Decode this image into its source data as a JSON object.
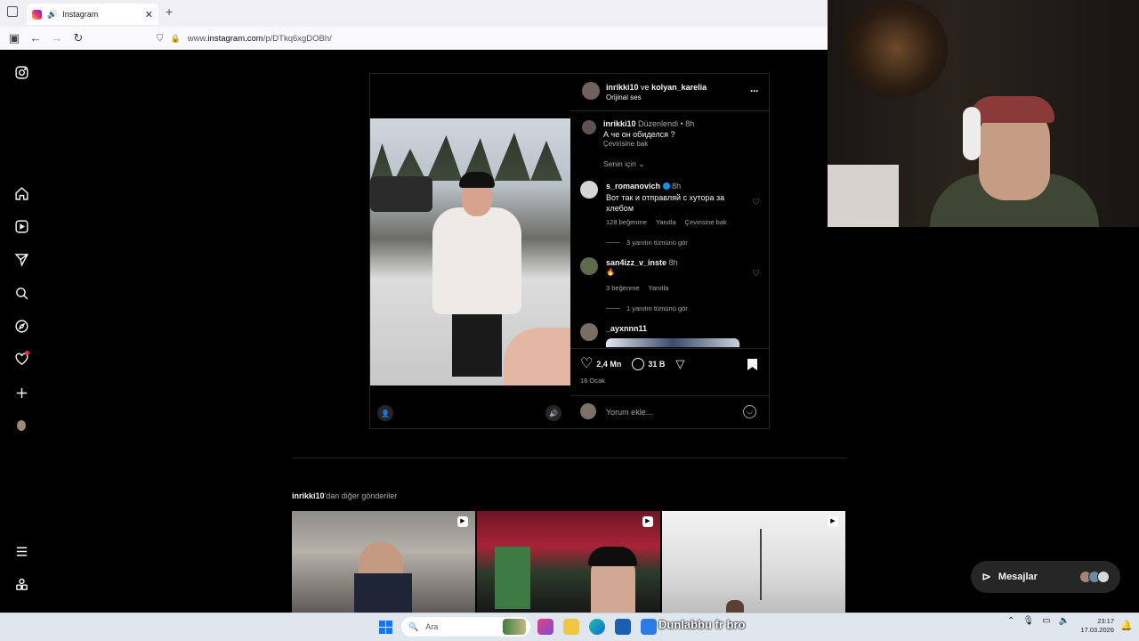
{
  "browser": {
    "tab_title": "Instagram",
    "tab_close": "✕",
    "new_tab": "+",
    "url_prefix": "www.",
    "url_host": "instagram.com",
    "url_path": "/p/DTkq6xgDOBh/"
  },
  "sidebar": {
    "items": [
      {
        "icon": "instagram-logo-icon"
      },
      {
        "icon": "home-icon"
      },
      {
        "icon": "reels-icon"
      },
      {
        "icon": "direct-icon"
      },
      {
        "icon": "search-icon"
      },
      {
        "icon": "explore-icon"
      },
      {
        "icon": "notifications-heart-icon"
      },
      {
        "icon": "create-plus-icon"
      },
      {
        "icon": "profile-avatar"
      },
      {
        "icon": "more-menu-icon"
      },
      {
        "icon": "also-from-meta-icon"
      }
    ]
  },
  "post": {
    "header": {
      "user1": "inrikki10",
      "connector": "ve",
      "user2": "kolyan_karelia",
      "audio": "Orijinal ses",
      "more": "···"
    },
    "caption": {
      "user": "inrikki10",
      "edited": "Düzenlendi",
      "time": "8h",
      "text": "А че он обиделся ?",
      "translate": "Çevirisine bak"
    },
    "for_you": "Senin için",
    "comments": [
      {
        "user": "s_romanovich",
        "time": "8h",
        "text": "Вот так и отправляй с хутора за хлебом",
        "likes": "128 beğenme",
        "reply": "Yanıtla",
        "translate": "Çevirisine bak",
        "view_replies": "3 yanıtın tümünü gör"
      },
      {
        "user": "san4izz_v_inste",
        "time": "8h",
        "text": "🔥",
        "likes": "3 beğenme",
        "reply": "Yanıtla",
        "view_replies": "1 yanıtın tümünü gör"
      },
      {
        "user": "_ayxnnn11"
      }
    ],
    "actions": {
      "likes": "2,4 Mn",
      "comments": "31 B"
    },
    "date": "16 Ocak",
    "comment_placeholder": "Yorum ekle..."
  },
  "more_posts": {
    "user": "inrikki10",
    "suffix": "'dan diğer gönderiler"
  },
  "messages": {
    "label": "Mesajlar"
  },
  "taskbar": {
    "search": "Ara",
    "overlay": "Dunlabbu fr bro",
    "time": "23:17",
    "date": "17.03.2026"
  },
  "colors": {
    "background": "#000000",
    "panel_border": "#262626",
    "verified": "#0095f6",
    "notification_dot": "#ff3040"
  }
}
